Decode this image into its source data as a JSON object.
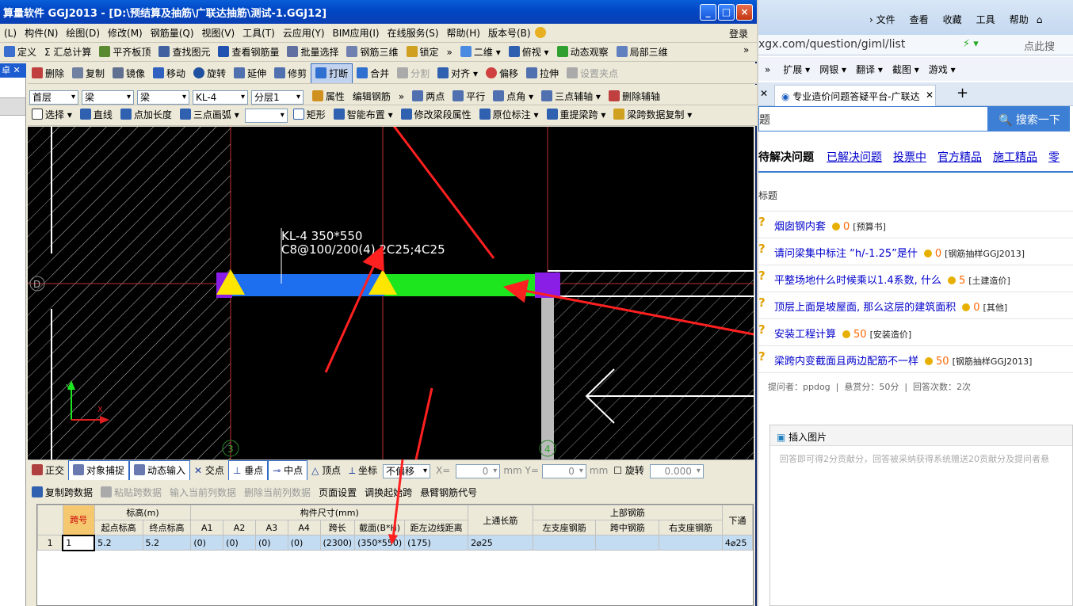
{
  "app": {
    "title": "算量软件 GGJ2013 - [D:\\预结算及抽筋\\广联达抽筋\\测试-1.GGJ12]",
    "login": "登录"
  },
  "menu": [
    "(L)",
    "构件(N)",
    "绘图(D)",
    "修改(M)",
    "钢筋量(Q)",
    "视图(V)",
    "工具(T)",
    "云应用(Y)",
    "BIM应用(I)",
    "在线服务(S)",
    "帮助(H)",
    "版本号(B)"
  ],
  "toolbar1": [
    "定义",
    "Σ 汇总计算",
    "平齐板顶",
    "查找图元",
    "查看钢筋量",
    "批量选择",
    "钢筋三维",
    "锁定"
  ],
  "toolbar1b": {
    "view2d": "二维",
    "top_view": "俯视",
    "dynamic": "动态观察",
    "local3d": "局部三维"
  },
  "toolbar2": [
    "删除",
    "复制",
    "镜像",
    "移动",
    "旋转",
    "延伸",
    "修剪",
    "打断",
    "合并",
    "分割",
    "对齐",
    "偏移",
    "拉伸",
    "设置夹点"
  ],
  "toolbar3": {
    "floor": "首层",
    "type1": "梁",
    "type2": "梁",
    "name": "KL-4",
    "layer": "分层1",
    "attr": "属性",
    "edit_rebar": "编辑钢筋",
    "two_point": "两点",
    "parallel": "平行",
    "point_angle": "点角",
    "three_point_aux": "三点辅轴",
    "del_aux": "删除辅轴"
  },
  "toolbar4": [
    "选择",
    "直线",
    "点加长度",
    "三点画弧",
    "矩形",
    "智能布置",
    "修改梁段属性",
    "原位标注",
    "重提梁跨",
    "梁跨数据复制"
  ],
  "canvas": {
    "beam_label1": "KL-4 350*550",
    "beam_label2": "C8@100/200(4) 2C25;4C25",
    "axis_d": "D",
    "axis_3": "3",
    "axis_4": "4"
  },
  "snapbar": {
    "ortho": "正交",
    "snap": "对象捕捉",
    "dyn": "动态输入",
    "intersect": "交点",
    "perp": "垂点",
    "mid": "中点",
    "vertex": "顶点",
    "coord": "坐标",
    "offset": "不偏移",
    "x_label": "X=",
    "x_val": "0",
    "y_label": "mm Y=",
    "y_val": "0",
    "unit": "mm",
    "rotate": "旋转",
    "rot_val": "0.000"
  },
  "gridtools": [
    "复制跨数据",
    "粘贴跨数据",
    "输入当前列数据",
    "删除当前列数据",
    "页面设置",
    "调换起始跨",
    "悬臂钢筋代号"
  ],
  "table": {
    "h_span": "跨号",
    "h_elev": "标高(m)",
    "h_start": "起点标高",
    "h_end": "终点标高",
    "h_dim": "构件尺寸(mm)",
    "h_a": [
      "A1",
      "A2",
      "A3",
      "A4"
    ],
    "h_len": "跨长",
    "h_sec": "截面(B*H)",
    "h_dist": "距左边线距离",
    "h_top_through": "上通长筋",
    "h_top": "上部钢筋",
    "h_left": "左支座钢筋",
    "h_mid": "跨中钢筋",
    "h_right": "右支座钢筋",
    "h_bottom": "下通",
    "row": {
      "idx": "1",
      "span": "1",
      "start": "5.2",
      "end": "5.2",
      "a1": "(0)",
      "a2": "(0)",
      "a3": "(0)",
      "a4": "(0)",
      "len": "(2300)",
      "sec": "(350*550)",
      "dist": "(175)",
      "top_through": "2⌀25",
      "left": "",
      "mid": "",
      "right": "",
      "bottom": "4⌀25"
    }
  },
  "browser": {
    "menu": [
      "文件",
      "查看",
      "收藏",
      "工具",
      "帮助"
    ],
    "url": "xgx.com/question/giml/list",
    "search_hint": "点此搜",
    "fav": [
      "扩展",
      "网银",
      "翻译",
      "截图",
      "游戏"
    ],
    "tab_title": "专业造价问题答疑平台-广联达",
    "search_partial": "题",
    "search_btn": "搜索一下",
    "nav": [
      "待解决问题",
      "已解决问题",
      "投票中",
      "官方精品",
      "施工精品",
      "零"
    ],
    "label": "标题",
    "questions": [
      {
        "title": "烟囱钢内套",
        "score": "0",
        "cat": "[预算书]"
      },
      {
        "title": "请问梁集中标注 “h/-1.25”是什",
        "score": "0",
        "cat": "[钢筋抽样GGJ2013]"
      },
      {
        "title": "平整场地什么时候乘以1.4系数, 什么",
        "score": "5",
        "cat": "[土建造价]"
      },
      {
        "title": "顶层上面是坡屋面, 那么这层的建筑面积",
        "score": "0",
        "cat": "[其他]"
      },
      {
        "title": "安装工程计算",
        "score": "50",
        "cat": "[安装造价]"
      },
      {
        "title": "梁跨内变截面且两边配筋不一样",
        "score": "50",
        "cat": "[钢筋抽样GGJ2013]"
      }
    ],
    "meta": "提问者：ppdog  |  悬赏分：50分  |  回答次数：2次",
    "insert_img": "插入图片",
    "answer_hint": "回答即可得2分贡献分，回答被采纳获得系统赠送20贡献分及提问者悬"
  },
  "colors": {
    "beam_blue": "#1e6ef0",
    "beam_green": "#1ee61e",
    "support_yellow": "#ffe600",
    "support_purple": "#8a1ee6",
    "arrow_red": "#ff2020"
  }
}
